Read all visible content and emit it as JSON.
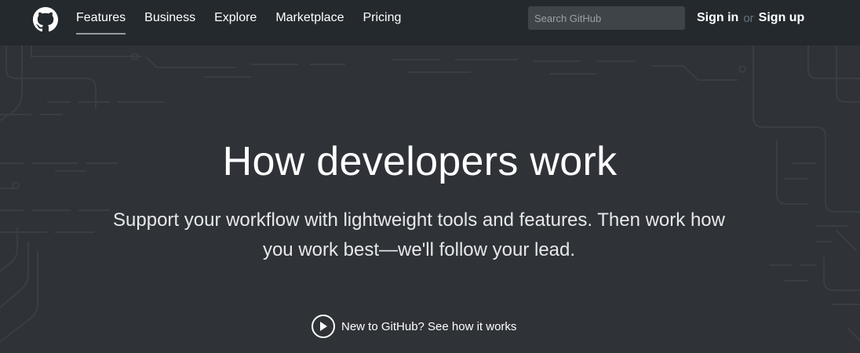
{
  "header": {
    "logo_icon": "github-mark-icon",
    "nav": [
      {
        "label": "Features",
        "active": true
      },
      {
        "label": "Business",
        "active": false
      },
      {
        "label": "Explore",
        "active": false
      },
      {
        "label": "Marketplace",
        "active": false
      },
      {
        "label": "Pricing",
        "active": false
      }
    ],
    "search": {
      "placeholder": "Search GitHub",
      "value": ""
    },
    "sign_in": "Sign in",
    "or": "or",
    "sign_up": "Sign up"
  },
  "hero": {
    "title": "How developers work",
    "subtitle": "Support your workflow with lightweight tools and features. Then work how you work best—we'll follow your lead.",
    "cta": {
      "icon": "play-circle-icon",
      "label": "New to GitHub? See how it works"
    }
  },
  "colors": {
    "header_bg": "#24292e",
    "hero_bg": "#2f3237",
    "circuit_line": "#3a3e44",
    "text": "#ffffff"
  }
}
